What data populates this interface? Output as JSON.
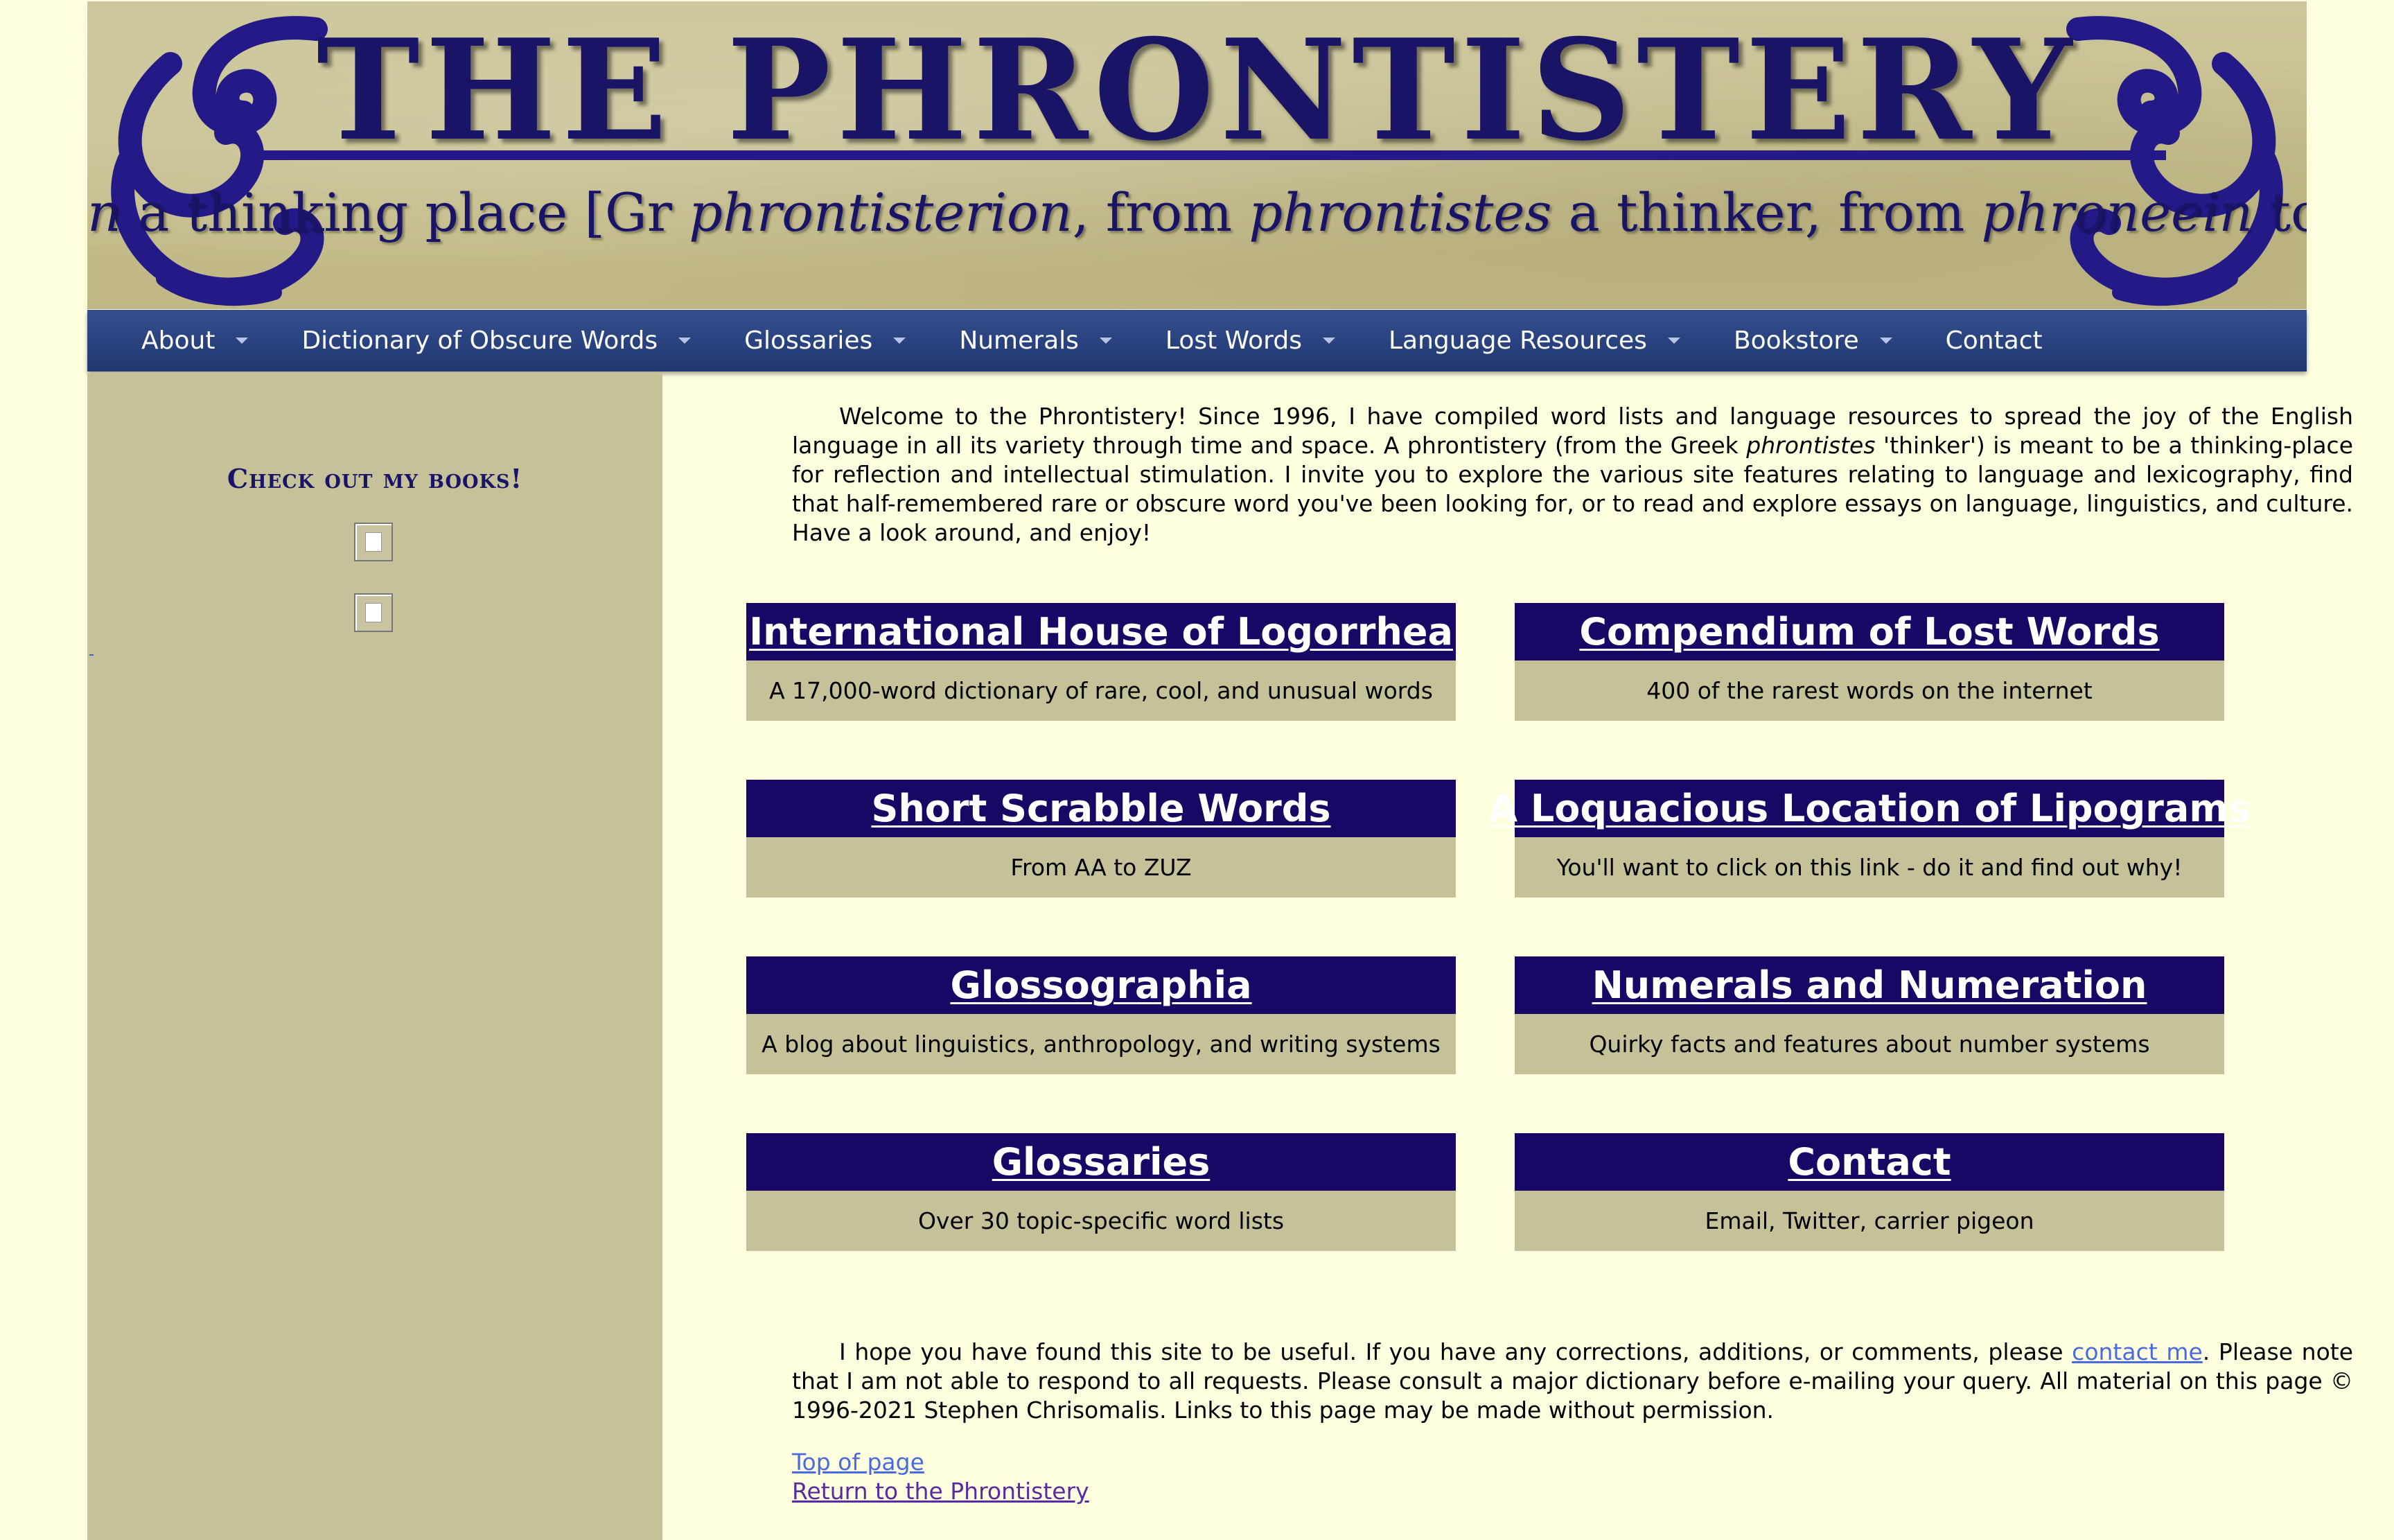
{
  "banner": {
    "title": "THE PHRONTISTERY",
    "subtitle_parts": [
      "n",
      " a thinking place [Gr ",
      "phrontisterion",
      ", from ",
      "phrontistes",
      " a thinker, from ",
      "phroneein",
      " to think]"
    ]
  },
  "nav": {
    "items": [
      {
        "label": "About",
        "has_menu": true
      },
      {
        "label": "Dictionary of Obscure Words",
        "has_menu": true
      },
      {
        "label": "Glossaries",
        "has_menu": true
      },
      {
        "label": "Numerals",
        "has_menu": true
      },
      {
        "label": "Lost Words",
        "has_menu": true
      },
      {
        "label": "Language Resources",
        "has_menu": true
      },
      {
        "label": "Bookstore",
        "has_menu": true
      },
      {
        "label": "Contact",
        "has_menu": false
      }
    ]
  },
  "sidebar": {
    "heading": "Check out my books!"
  },
  "intro": {
    "part1": "Welcome to the Phrontistery! Since 1996, I have compiled word lists and language resources to spread the joy of the English language in all its variety through time and space. A phrontistery (from the Greek ",
    "italic": "phrontistes",
    "part2": " 'thinker') is meant to be a thinking-place for reflection and intellectual stimulation. I invite you to explore the various site features relating to language and lexicography, find that half-remembered rare or obscure word you've been looking for, or to read and explore essays on language, linguistics, and culture. Have a look around, and enjoy!"
  },
  "cards": [
    {
      "title": "International House of Logorrhea",
      "desc": "A 17,000-word dictionary of rare, cool, and unusual words"
    },
    {
      "title": "Compendium of Lost Words",
      "desc": "400 of the rarest words on the internet"
    },
    {
      "title": "Short Scrabble Words",
      "desc": "From AA to ZUZ"
    },
    {
      "title": "A Loquacious Location of Lipograms",
      "desc": "You'll want to click on this link - do it and find out why!"
    },
    {
      "title": "Glossographia",
      "desc": "A blog about linguistics, anthropology, and writing systems"
    },
    {
      "title": "Numerals and Numeration",
      "desc": "Quirky facts and features about number systems"
    },
    {
      "title": "Glossaries",
      "desc": "Over 30 topic-specific word lists"
    },
    {
      "title": "Contact",
      "desc": "Email, Twitter, carrier pigeon"
    }
  ],
  "outro": {
    "part1": "I hope you have found this site to be useful. If you have any corrections, additions, or comments, please ",
    "link": "contact me",
    "part2": ". Please note that I am not able to respond to all requests. Please consult a major dictionary before e-mailing your query. All material on this page © 1996-2021 Stephen Chrisomalis. Links to this page may be made without permission."
  },
  "footer": {
    "top_link": "Top of page",
    "return_link": "Return to the Phrontistery"
  },
  "colors": {
    "page_bg": "#ffffe0",
    "brand_navy": "#170866",
    "nav_blue": "#2a4380",
    "panel_khaki": "#c5c29a",
    "link_blue": "#4a6be0"
  }
}
